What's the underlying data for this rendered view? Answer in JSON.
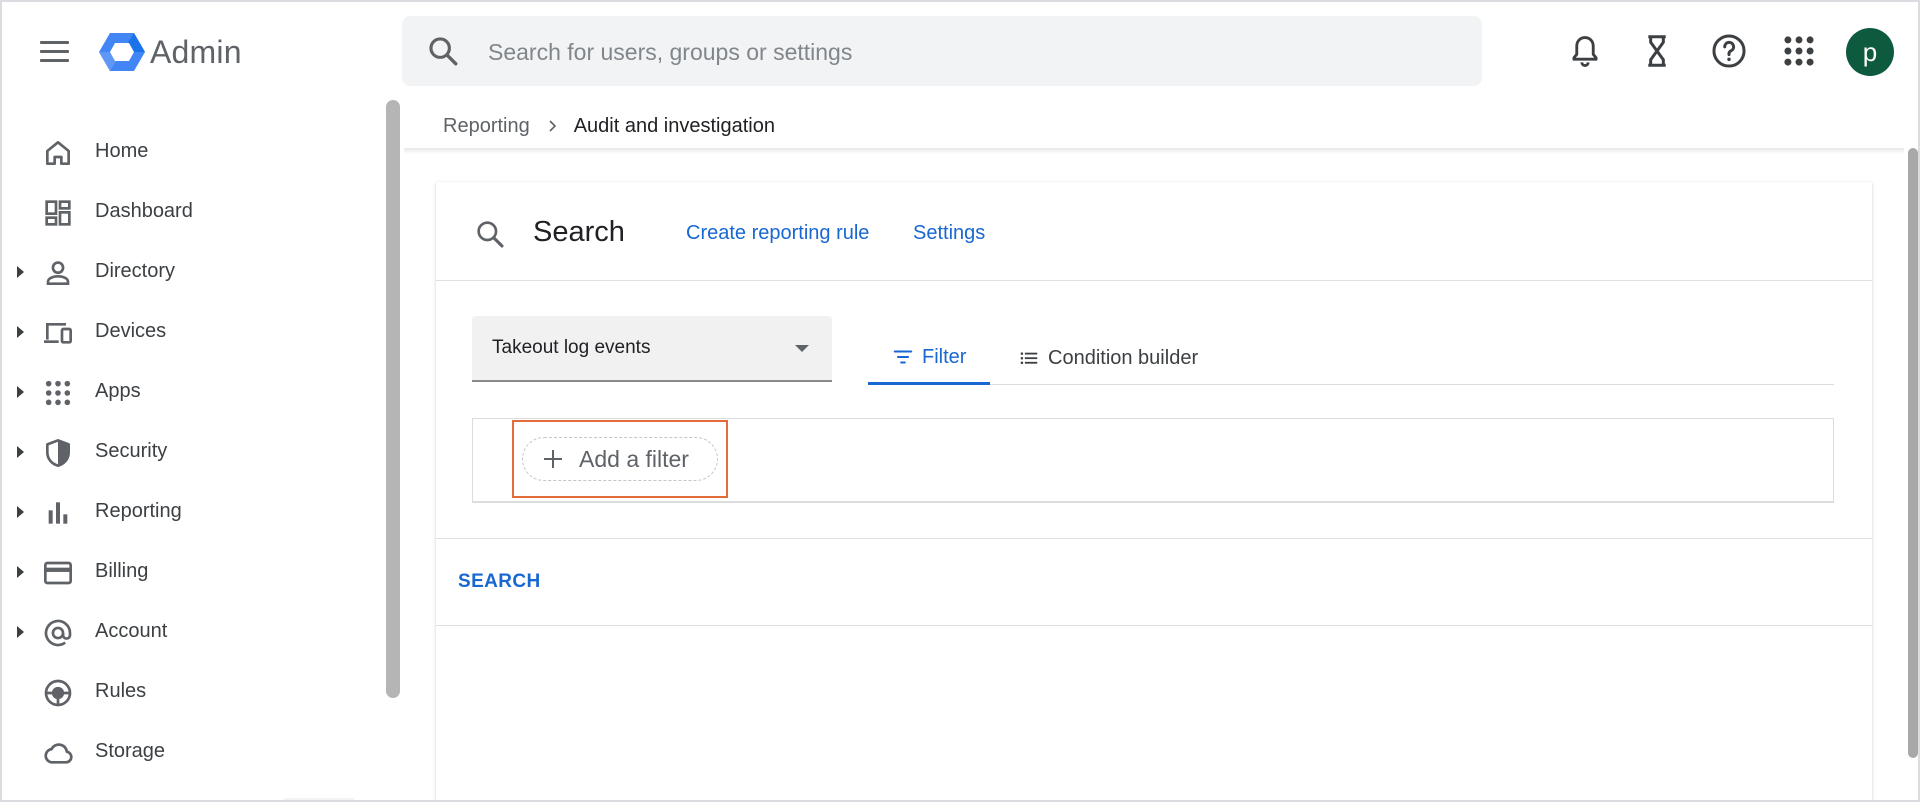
{
  "app": {
    "title": "Admin",
    "search_placeholder": "Search for users, groups or settings",
    "search_value": "",
    "avatar_letter": "p",
    "colors": {
      "avatar_bg": "#0d5a3f",
      "accent": "#1967d2",
      "highlight": "#e36d3a"
    },
    "icons": [
      "menu-icon",
      "admin-logo-icon",
      "search-icon",
      "bell-icon",
      "hourglass-icon",
      "help-icon",
      "apps-grid-icon"
    ]
  },
  "sidebar": {
    "items": [
      {
        "label": "Home",
        "icon": "home-icon",
        "expandable": false
      },
      {
        "label": "Dashboard",
        "icon": "dashboard-icon",
        "expandable": false
      },
      {
        "label": "Directory",
        "icon": "person-icon",
        "expandable": true
      },
      {
        "label": "Devices",
        "icon": "devices-icon",
        "expandable": true
      },
      {
        "label": "Apps",
        "icon": "apps-icon",
        "expandable": true
      },
      {
        "label": "Security",
        "icon": "shield-icon",
        "expandable": true
      },
      {
        "label": "Reporting",
        "icon": "bar-chart-icon",
        "expandable": true
      },
      {
        "label": "Billing",
        "icon": "credit-card-icon",
        "expandable": true
      },
      {
        "label": "Account",
        "icon": "at-sign-icon",
        "expandable": true
      },
      {
        "label": "Rules",
        "icon": "rules-icon",
        "expandable": false
      },
      {
        "label": "Storage",
        "icon": "cloud-icon",
        "expandable": false
      }
    ]
  },
  "breadcrumb": {
    "parent": "Reporting",
    "current": "Audit and investigation"
  },
  "card": {
    "title": "Search",
    "links": {
      "create_rule": "Create reporting rule",
      "settings": "Settings"
    },
    "select_value": "Takeout log events",
    "tabs": {
      "filter": "Filter",
      "condition_builder": "Condition builder"
    },
    "add_filter": "Add a filter",
    "search_action": "SEARCH"
  }
}
